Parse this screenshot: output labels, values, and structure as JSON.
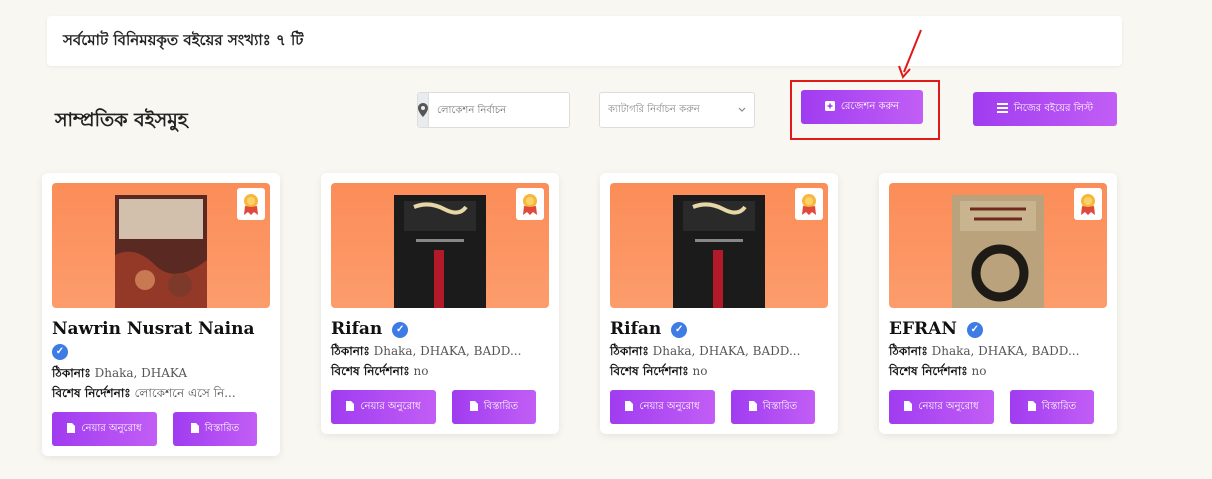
{
  "summary": {
    "text": "সর্বমোট বিনিময়কৃত বইয়ের সংখ্যাঃ ৭ টি"
  },
  "section_title": "সাম্প্রতিক বইসমুহ",
  "filters": {
    "location_placeholder": "লোকেশন নির্বাচন",
    "category_placeholder": "ক্যাটাগরি নির্বাচন করুন"
  },
  "buttons": {
    "add_label": "রেজেশন করুন",
    "my_books_label": "নিজের বইয়ের লিস্ট"
  },
  "labels": {
    "address": "ঠিকানাঃ",
    "special_note": "বিশেষ নির্দেশনাঃ",
    "request_button": "নেয়ার অনুরোধ",
    "details_button": "বিস্তারিত"
  },
  "cards": [
    {
      "owner": "Nawrin Nusrat Naina",
      "address": "Dhaka, DHAKA",
      "note": "লোকেশনে এসে নি...",
      "cover_color": "#5a2a22"
    },
    {
      "owner": "Rifan",
      "address": "Dhaka, DHAKA, BADD...",
      "note": "no",
      "cover_color": "#1b1b1b"
    },
    {
      "owner": "Rifan",
      "address": "Dhaka, DHAKA, BADD...",
      "note": "no",
      "cover_color": "#1b1b1b"
    },
    {
      "owner": "EFRAN",
      "address": "Dhaka, DHAKA, BADD...",
      "note": "no",
      "cover_color": "#b9a27c"
    }
  ],
  "colors": {
    "accent": "#a855f7",
    "card_header": "#fb8d58",
    "verified": "#3d7be5",
    "highlight": "#e01919"
  }
}
